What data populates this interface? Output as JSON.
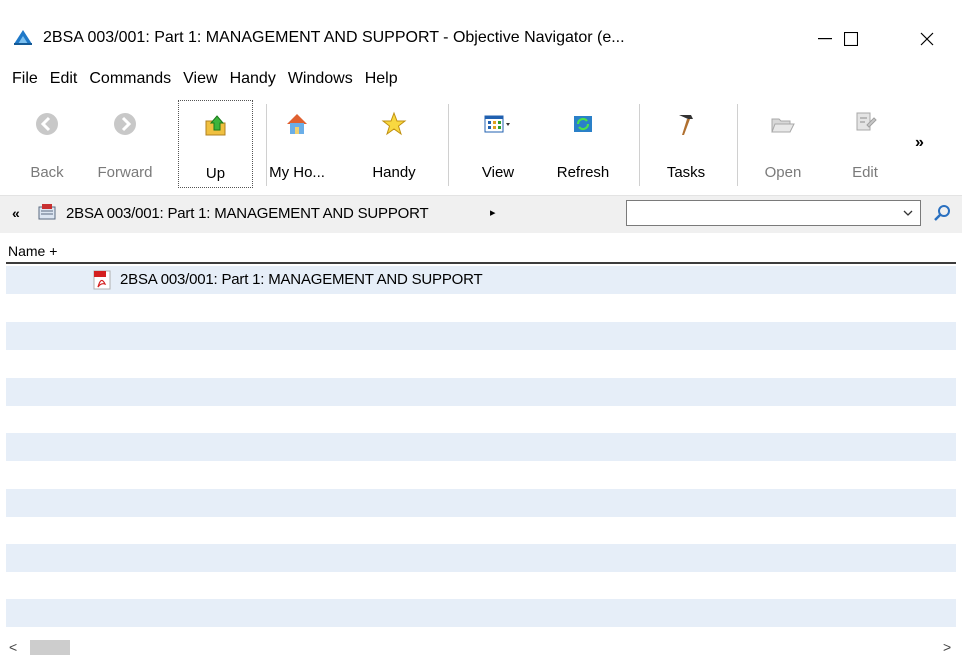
{
  "window": {
    "title": "2BSA 003/001: Part 1: MANAGEMENT AND SUPPORT - Objective Navigator (e...",
    "controls": {
      "minimize": "—",
      "maximize": "☐",
      "close": "✕"
    }
  },
  "menu": [
    "File",
    "Edit",
    "Commands",
    "View",
    "Handy",
    "Windows",
    "Help"
  ],
  "toolbar": {
    "buttons": [
      {
        "label": "Back",
        "icon": "back-arrow-icon",
        "disabled": true
      },
      {
        "label": "Forward",
        "icon": "forward-arrow-icon",
        "disabled": true
      },
      {
        "label": "Up",
        "icon": "up-folder-icon",
        "disabled": false
      },
      {
        "label": "My Ho...",
        "icon": "home-icon",
        "disabled": false
      },
      {
        "label": "Handy",
        "icon": "star-icon",
        "disabled": false
      },
      {
        "label": "View",
        "icon": "view-grid-icon",
        "disabled": false
      },
      {
        "label": "Refresh",
        "icon": "refresh-icon",
        "disabled": false
      },
      {
        "label": "Tasks",
        "icon": "hammer-icon",
        "disabled": false
      },
      {
        "label": "Open",
        "icon": "open-folder-icon",
        "disabled": true
      },
      {
        "label": "Edit",
        "icon": "edit-document-icon",
        "disabled": true
      }
    ],
    "more": "»"
  },
  "address": {
    "back_chevron": "«",
    "path": "2BSA 003/001: Part 1: MANAGEMENT AND SUPPORT",
    "arrow": "▸",
    "search_value": ""
  },
  "list": {
    "column_header": "Name +",
    "rows": [
      "2BSA 003/001: Part 1: MANAGEMENT AND SUPPORT"
    ]
  },
  "scrollbar": {
    "left": "<",
    "right": ">"
  }
}
